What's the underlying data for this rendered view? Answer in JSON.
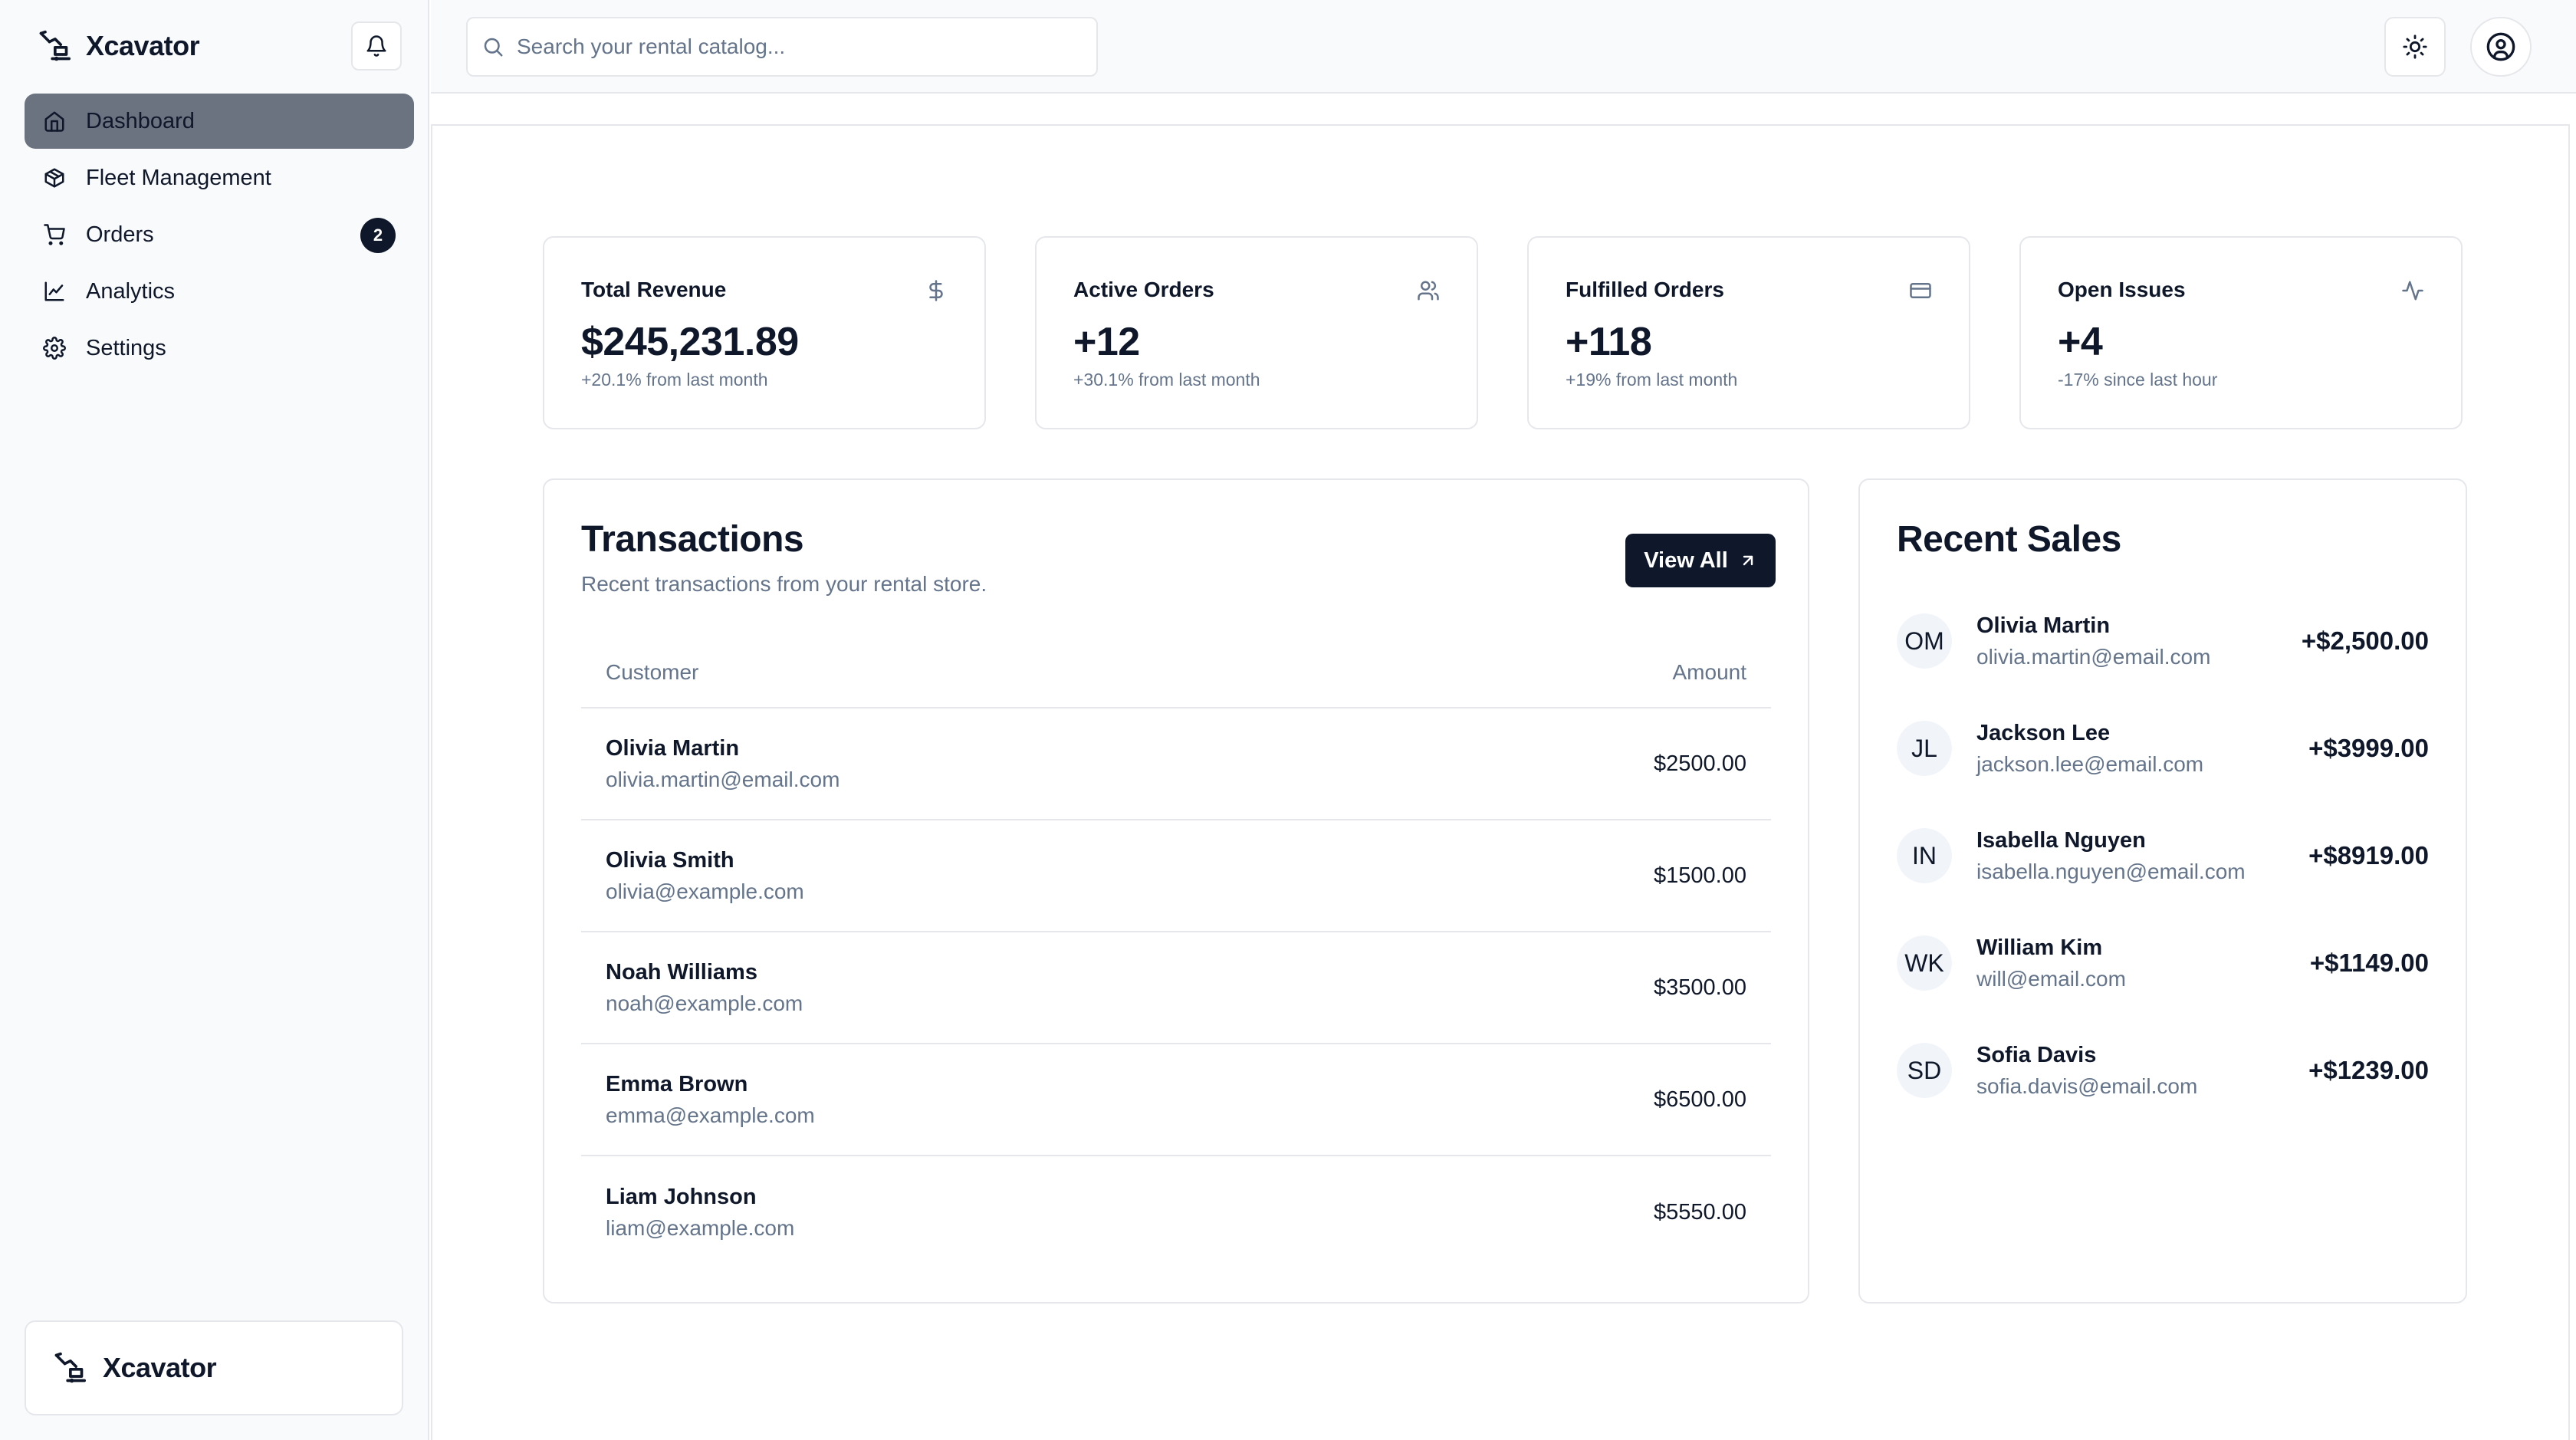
{
  "app": {
    "name": "Xcavator"
  },
  "sidebar": {
    "items": [
      {
        "label": "Dashboard",
        "icon": "home-icon",
        "active": true
      },
      {
        "label": "Fleet Management",
        "icon": "package-icon"
      },
      {
        "label": "Orders",
        "icon": "shopping-cart-icon",
        "badge": "2"
      },
      {
        "label": "Analytics",
        "icon": "line-chart-icon"
      },
      {
        "label": "Settings",
        "icon": "gear-icon"
      }
    ],
    "footer_name": "Xcavator"
  },
  "search": {
    "placeholder": "Search your rental catalog..."
  },
  "stats": [
    {
      "label": "Total Revenue",
      "value": "$245,231.89",
      "change": "+20.1% from last month",
      "icon": "dollar-icon"
    },
    {
      "label": "Active Orders",
      "value": "+12",
      "change": "+30.1% from last month",
      "icon": "users-icon"
    },
    {
      "label": "Fulfilled Orders",
      "value": "+118",
      "change": "+19% from last month",
      "icon": "credit-card-icon"
    },
    {
      "label": "Open Issues",
      "value": "+4",
      "change": "-17% since last hour",
      "icon": "activity-icon"
    }
  ],
  "transactions": {
    "title": "Transactions",
    "subtitle": "Recent transactions from your rental store.",
    "view_all": "View All",
    "columns": {
      "customer": "Customer",
      "amount": "Amount"
    },
    "rows": [
      {
        "name": "Olivia Martin",
        "email": "olivia.martin@email.com",
        "amount": "$2500.00"
      },
      {
        "name": "Olivia Smith",
        "email": "olivia@example.com",
        "amount": "$1500.00"
      },
      {
        "name": "Noah Williams",
        "email": "noah@example.com",
        "amount": "$3500.00"
      },
      {
        "name": "Emma Brown",
        "email": "emma@example.com",
        "amount": "$6500.00"
      },
      {
        "name": "Liam Johnson",
        "email": "liam@example.com",
        "amount": "$5550.00"
      }
    ]
  },
  "recent_sales": {
    "title": "Recent Sales",
    "items": [
      {
        "initials": "OM",
        "name": "Olivia Martin",
        "email": "olivia.martin@email.com",
        "amount": "+$2,500.00"
      },
      {
        "initials": "JL",
        "name": "Jackson Lee",
        "email": "jackson.lee@email.com",
        "amount": "+$3999.00"
      },
      {
        "initials": "IN",
        "name": "Isabella Nguyen",
        "email": "isabella.nguyen@email.com",
        "amount": "+$8919.00"
      },
      {
        "initials": "WK",
        "name": "William Kim",
        "email": "will@email.com",
        "amount": "+$1149.00"
      },
      {
        "initials": "SD",
        "name": "Sofia Davis",
        "email": "sofia.davis@email.com",
        "amount": "+$1239.00"
      }
    ]
  }
}
